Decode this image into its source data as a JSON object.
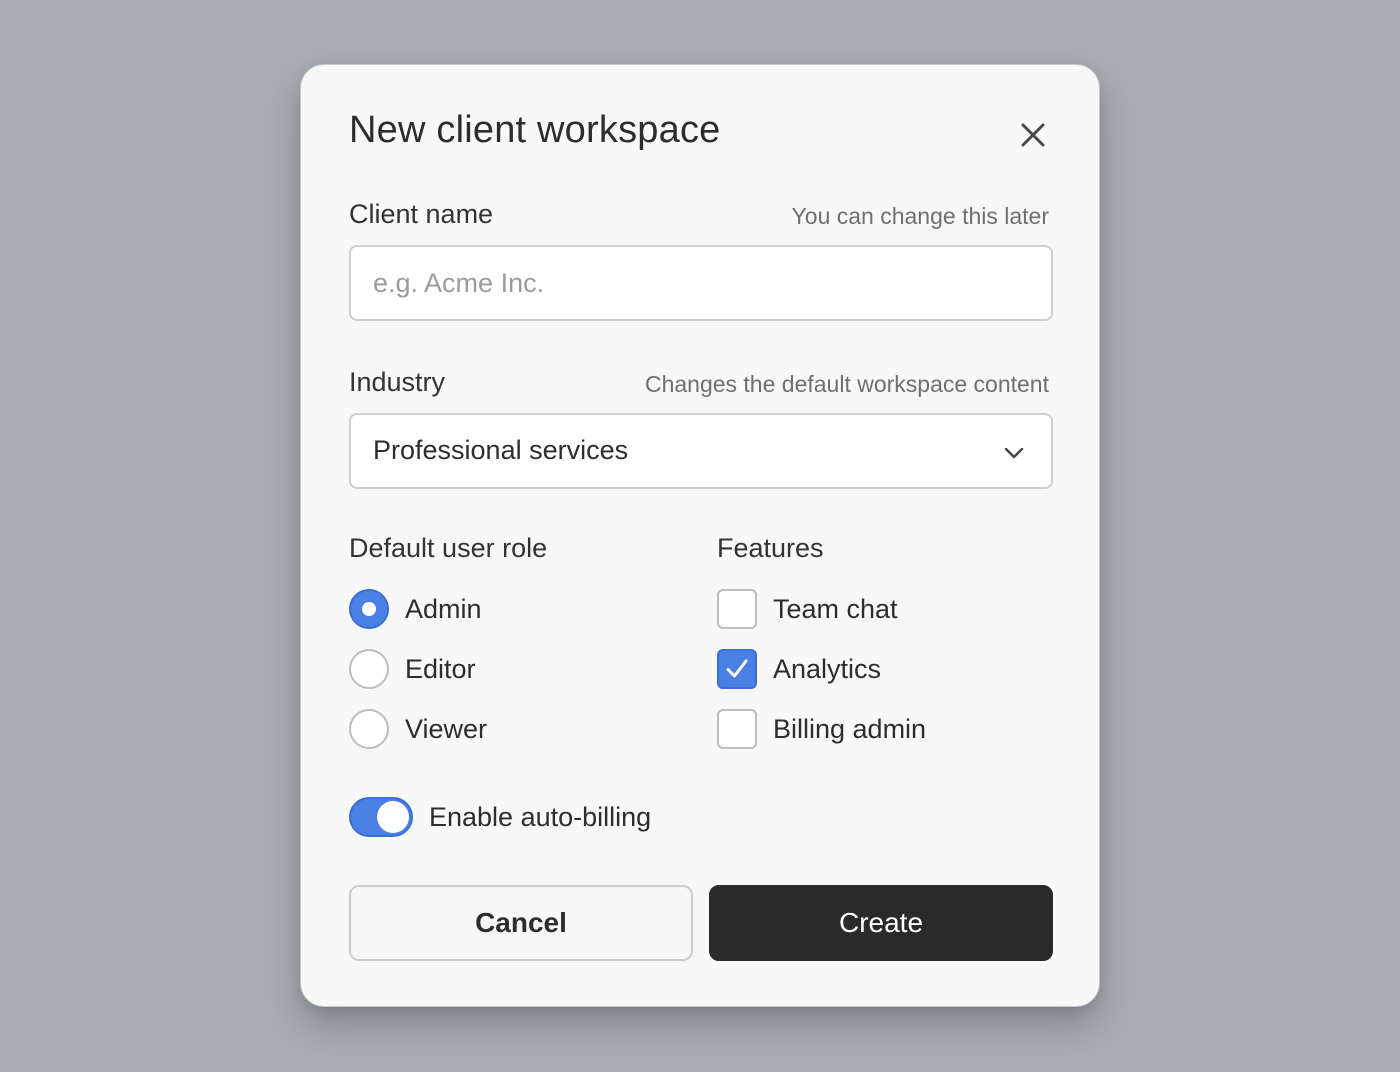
{
  "dialog": {
    "title": "New client workspace",
    "close_icon": "close-icon"
  },
  "client_name": {
    "label": "Client name",
    "hint": "You can change this later",
    "value": "",
    "placeholder": "e.g. Acme Inc."
  },
  "industry": {
    "label": "Industry",
    "hint": "Changes the default workspace content",
    "selected": "Professional services",
    "icon": "chevron-down-icon"
  },
  "default_user_role": {
    "title": "Default user role",
    "options": [
      {
        "label": "Admin",
        "checked": true
      },
      {
        "label": "Editor",
        "checked": false
      },
      {
        "label": "Viewer",
        "checked": false
      }
    ]
  },
  "features": {
    "title": "Features",
    "options": [
      {
        "label": "Team chat",
        "checked": false
      },
      {
        "label": "Analytics",
        "checked": true
      },
      {
        "label": "Billing admin",
        "checked": false
      }
    ]
  },
  "auto_billing": {
    "label": "Enable auto-billing",
    "on": true
  },
  "actions": {
    "cancel_label": "Cancel",
    "create_label": "Create"
  },
  "colors": {
    "accent": "#4a7fe3",
    "primary_button": "#2a2a2a",
    "backdrop": "#a9acb4"
  }
}
